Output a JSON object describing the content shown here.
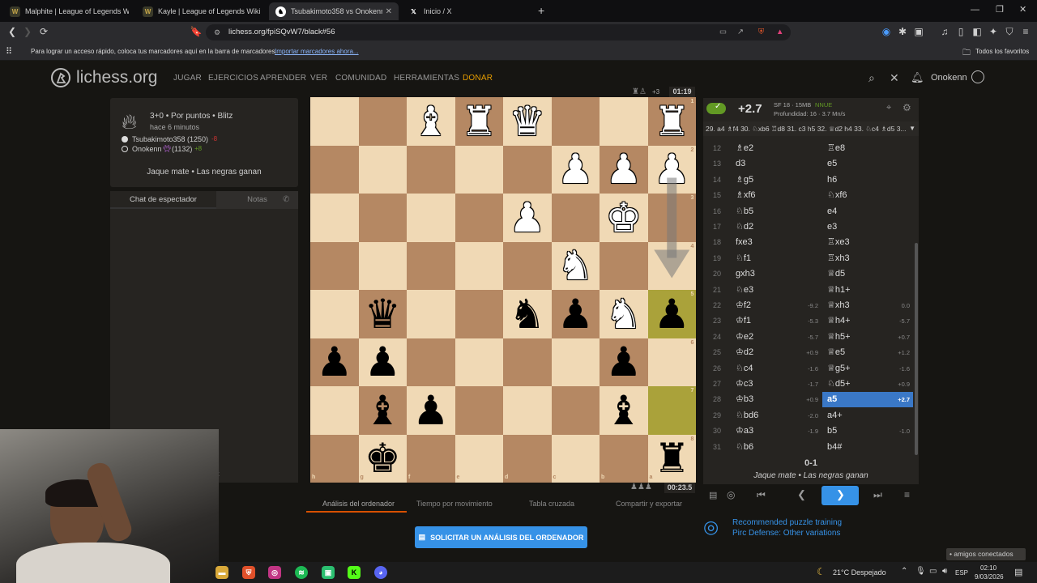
{
  "browser": {
    "tabs": [
      {
        "title": "Malphite | League of Legends Wiki",
        "icon": "wiki-icon"
      },
      {
        "title": "Kayle | League of Legends Wiki",
        "icon": "wiki-icon"
      },
      {
        "title": "Tsubakimoto358 vs Onokenn",
        "icon": "lichess-icon",
        "active": true
      },
      {
        "title": "Inicio / X",
        "icon": "x-icon"
      }
    ],
    "url": "lichess.org/fpiSQvW7/black#56",
    "bookmarks_prompt": "Para lograr un acceso rápido, coloca tus marcadores aquí en la barra de marcadores.",
    "bookmarks_link": "Importar marcadores ahora...",
    "all_bookmarks": "Todos los favoritos"
  },
  "site": {
    "logo": "lichess.org",
    "nav": [
      "JUGAR",
      "EJERCICIOS",
      "APRENDER",
      "VER",
      "COMUNIDAD",
      "HERRAMIENTAS",
      "DONAR"
    ],
    "username": "Onokenn"
  },
  "game": {
    "type": "3+0 • Por puntos • Blitz",
    "ago": "hace 6 minutos",
    "white_player": "Tsubakimoto358 (1250)",
    "white_delta": "-8",
    "black_player": "Onokenn",
    "black_rating": "(1132)",
    "black_delta": "+8",
    "result_text": "Jaque mate • Las negras ganan",
    "top_material": "+3",
    "top_clock": "01:19",
    "bottom_clock": "00:23.5"
  },
  "chat": {
    "tab_chat": "Chat de espectador",
    "tab_notes": "Notas",
    "placeholder_fragment": "nt"
  },
  "engine": {
    "eval": "+2.7",
    "engine_name": "SF 18 · 15MB",
    "nnue": "NNUE",
    "depth": "Profundidad: 16 · 3.7 Mn/s",
    "pv": "29. a4 ♗f4 30. ♘xb6 ♖d8 31. c3 h5 32. ♕d2 h4 33. ♘c4 ♗d5 3..."
  },
  "moves": [
    {
      "n": "12",
      "w": "♗e2",
      "b": "♖e8"
    },
    {
      "n": "13",
      "w": "d3",
      "b": "e5"
    },
    {
      "n": "14",
      "w": "♗g5",
      "b": "h6"
    },
    {
      "n": "15",
      "w": "♗xf6",
      "b": "♘xf6"
    },
    {
      "n": "16",
      "w": "♘b5",
      "b": "e4"
    },
    {
      "n": "17",
      "w": "♘d2",
      "b": "e3"
    },
    {
      "n": "18",
      "w": "fxe3",
      "b": "♖xe3"
    },
    {
      "n": "19",
      "w": "♘f1",
      "b": "♖xh3"
    },
    {
      "n": "20",
      "w": "gxh3",
      "b": "♕d5"
    },
    {
      "n": "21",
      "w": "♘e3",
      "b": "♕h1+"
    },
    {
      "n": "22",
      "w": "♔f2",
      "we": "-9.2",
      "b": "♕xh3",
      "be": "0.0"
    },
    {
      "n": "23",
      "w": "♔f1",
      "we": "-5.3",
      "b": "♕h4+",
      "be": "-5.7"
    },
    {
      "n": "24",
      "w": "♔e2",
      "we": "-5.7",
      "b": "♕h5+",
      "be": "+0.7"
    },
    {
      "n": "25",
      "w": "♔d2",
      "we": "+0.9",
      "b": "♕e5",
      "be": "+1.2"
    },
    {
      "n": "26",
      "w": "♘c4",
      "we": "-1.6",
      "b": "♕g5+",
      "be": "-1.6"
    },
    {
      "n": "27",
      "w": "♔c3",
      "we": "-1.7",
      "b": "♘d5+",
      "be": "+0.9"
    },
    {
      "n": "28",
      "w": "♔b3",
      "we": "+0.9",
      "b": "a5",
      "be": "+2.7",
      "selected": true
    },
    {
      "n": "29",
      "w": "♘bd6",
      "we": "-2.0",
      "b": "a4+",
      "be": ""
    },
    {
      "n": "30",
      "w": "♔a3",
      "we": "-1.9",
      "b": "b5",
      "be": "-1.0"
    },
    {
      "n": "31",
      "w": "♘b6",
      "we": "",
      "b": "b4#",
      "be": ""
    }
  ],
  "result": {
    "score": "0-1",
    "text": "Jaque mate • Las negras ganan"
  },
  "under_tabs": [
    "Análisis del ordenador",
    "Tiempo por movimiento",
    "Tabla cruzada",
    "Compartir y exportar"
  ],
  "analysis_button": "SOLICITAR UN ANÁLISIS DEL ORDENADOR",
  "puzzle": {
    "line1": "Recommended puzzle training",
    "line2": "Pirc Defense: Other variations"
  },
  "board": {
    "orientation": "black",
    "files": [
      "h",
      "g",
      "f",
      "e",
      "d",
      "c",
      "b",
      "a"
    ],
    "ranks": [
      "1",
      "2",
      "3",
      "4",
      "5",
      "6",
      "7",
      "8"
    ],
    "highlight_squares": [
      "a5",
      "a7"
    ],
    "pieces": [
      {
        "sq": "f1",
        "p": "♝",
        "c": "w"
      },
      {
        "sq": "e1",
        "p": "♜",
        "c": "w"
      },
      {
        "sq": "d1",
        "p": "♛",
        "c": "w"
      },
      {
        "sq": "a1",
        "p": "♜",
        "c": "w"
      },
      {
        "sq": "c2",
        "p": "♟",
        "c": "w"
      },
      {
        "sq": "b2",
        "p": "♟",
        "c": "w"
      },
      {
        "sq": "a2",
        "p": "♟",
        "c": "w"
      },
      {
        "sq": "d3",
        "p": "♟",
        "c": "w"
      },
      {
        "sq": "b3",
        "p": "♚",
        "c": "w"
      },
      {
        "sq": "c4",
        "p": "♞",
        "c": "w"
      },
      {
        "sq": "g5",
        "p": "♛",
        "c": "b"
      },
      {
        "sq": "d5",
        "p": "♞",
        "c": "b"
      },
      {
        "sq": "c5",
        "p": "♟",
        "c": "b"
      },
      {
        "sq": "b5",
        "p": "♞",
        "c": "w"
      },
      {
        "sq": "a5",
        "p": "♟",
        "c": "b"
      },
      {
        "sq": "h6",
        "p": "♟",
        "c": "b"
      },
      {
        "sq": "g6",
        "p": "♟",
        "c": "b"
      },
      {
        "sq": "b6",
        "p": "♟",
        "c": "b"
      },
      {
        "sq": "g7",
        "p": "♝",
        "c": "b"
      },
      {
        "sq": "f7",
        "p": "♟",
        "c": "b"
      },
      {
        "sq": "b7",
        "p": "♝",
        "c": "b"
      },
      {
        "sq": "g8",
        "p": "♚",
        "c": "b"
      },
      {
        "sq": "a8",
        "p": "♜",
        "c": "b"
      }
    ]
  },
  "taskbar": {
    "weather": "21°C  Despejado",
    "lang": "ESP",
    "time": "02:10",
    "date": "9/03/2026",
    "friends": "amigos conectados"
  },
  "colors": {
    "accent": "#3692e7",
    "donate": "#e69d00",
    "light_sq": "#f0d9b5",
    "dark_sq": "#b58863",
    "highlight": "#aaa23a",
    "selected_move": "#3a78c7"
  }
}
